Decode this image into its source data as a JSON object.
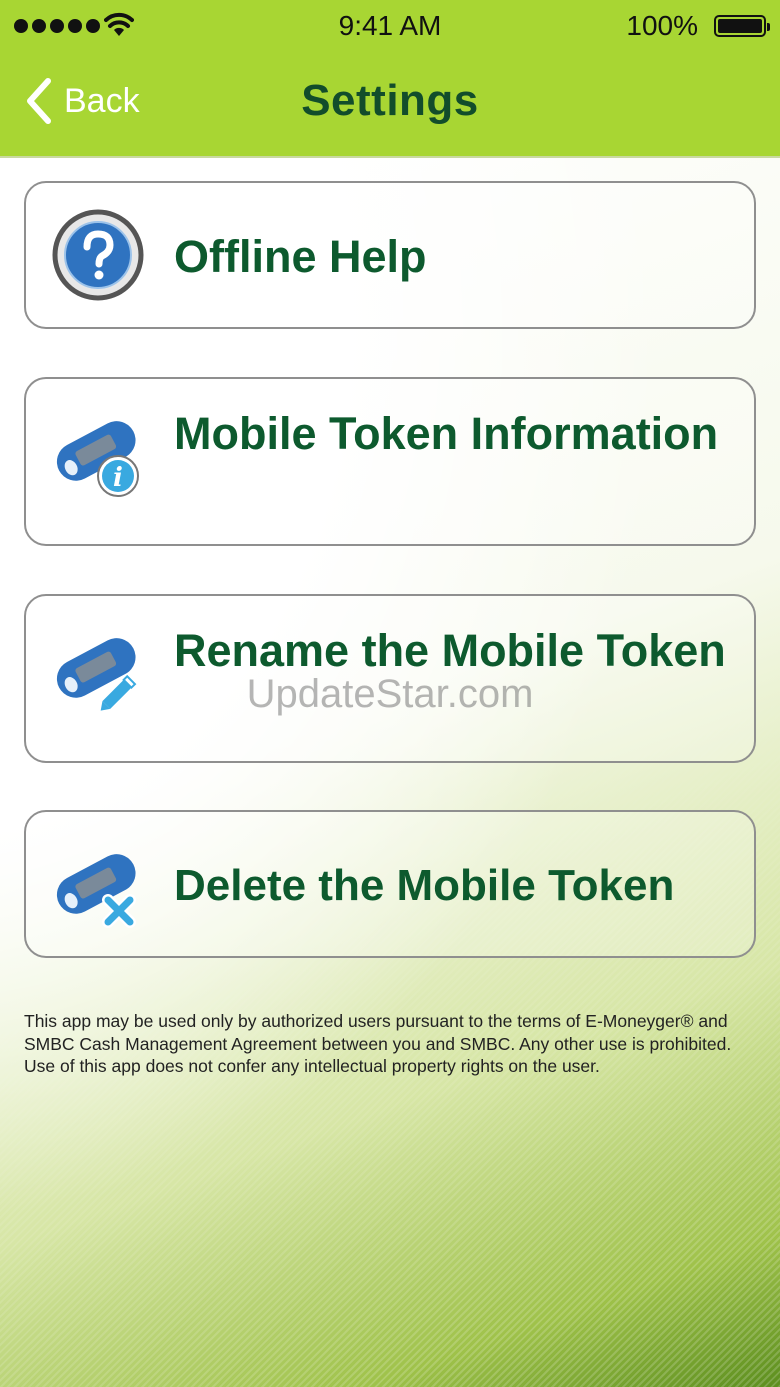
{
  "status_bar": {
    "time": "9:41 AM",
    "battery": "100%"
  },
  "nav": {
    "back_label": "Back",
    "title": "Settings"
  },
  "menu": {
    "items": [
      {
        "label": "Offline Help",
        "icon": "help-icon"
      },
      {
        "label": "Mobile Token Information",
        "icon": "token-info-icon"
      },
      {
        "label": "Rename the Mobile Token",
        "icon": "token-edit-icon"
      },
      {
        "label": "Delete the Mobile Token",
        "icon": "token-delete-icon"
      }
    ]
  },
  "disclaimer": "This app may be used only by authorized users pursuant to the terms of E-Moneyger® and SMBC Cash Management Agreement between you and SMBC. Any other use is prohibited. Use of this app does not confer any intellectual property rights on the user.",
  "watermark": "UpdateStar.com",
  "colors": {
    "header_green": "#a8d633",
    "title_text": "#124d2b",
    "label_text": "#0d5a2e",
    "icon_blue": "#2f73c0"
  }
}
